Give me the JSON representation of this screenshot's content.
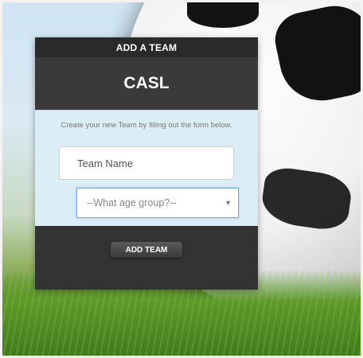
{
  "dialog": {
    "title": "ADD A TEAM",
    "brand": "CASL",
    "instructions": "Create your new Team by filling out the form below.",
    "team_name": {
      "placeholder": "Team Name",
      "value": ""
    },
    "age_group": {
      "selected": "--What age group?--"
    },
    "submit_label": "ADD TEAM"
  }
}
